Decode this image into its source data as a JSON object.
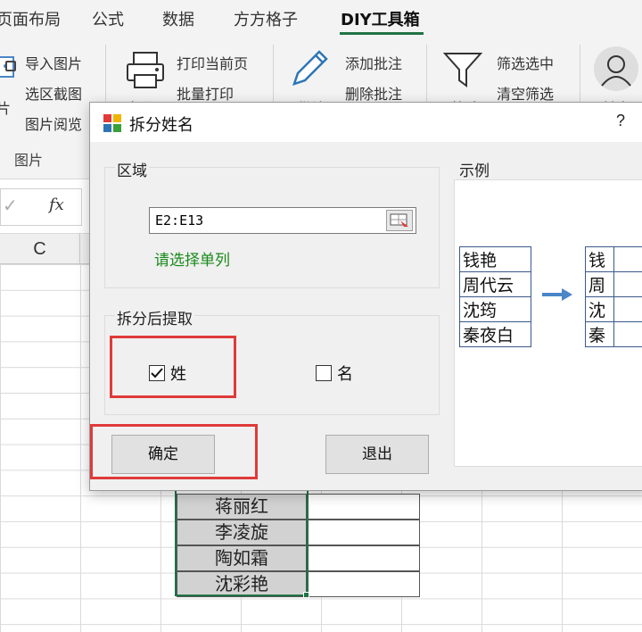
{
  "ribbon": {
    "tabs": [
      "页面布局",
      "公式",
      "数据",
      "方方格子",
      "DIY工具箱"
    ],
    "active_tab": "DIY工具箱",
    "accent_color": "#217346",
    "group_picture": {
      "items": [
        "导入图片",
        "选区截图",
        "图片阅览"
      ],
      "partial_label": "片",
      "group_label": "图片"
    },
    "group_print": {
      "big_label": "打印",
      "items": [
        "打印当前页",
        "批量打印"
      ]
    },
    "group_comment": {
      "big_label": "批注",
      "items": [
        "添加批注",
        "删除批注"
      ]
    },
    "group_filter": {
      "big_label": "筛选",
      "items": [
        "筛选选中",
        "清空筛选"
      ]
    },
    "group_name": {
      "big_label": "姓名"
    }
  },
  "formula_bar": {
    "cancel_icon": "check-icon",
    "fx_label": "fx"
  },
  "sheet": {
    "visible_column": "C",
    "names": [
      "蒋丽红",
      "李凌旋",
      "陶如霜",
      "沈彩艳"
    ]
  },
  "dialog": {
    "title": "拆分姓名",
    "help": "?",
    "range_group_title": "区域",
    "range_value": "E2:E13",
    "hint": "请选择单列",
    "extract_group_title": "拆分后提取",
    "options": [
      {
        "label": "姓",
        "checked": true
      },
      {
        "label": "名",
        "checked": false
      }
    ],
    "ok_label": "确定",
    "exit_label": "退出",
    "example_title": "示例",
    "example_left": [
      "钱艳",
      "周代云",
      "沈筠",
      "秦夜白"
    ],
    "example_right": [
      "钱",
      "周",
      "沈",
      "秦"
    ],
    "highlight_color": "#e03a3a"
  }
}
